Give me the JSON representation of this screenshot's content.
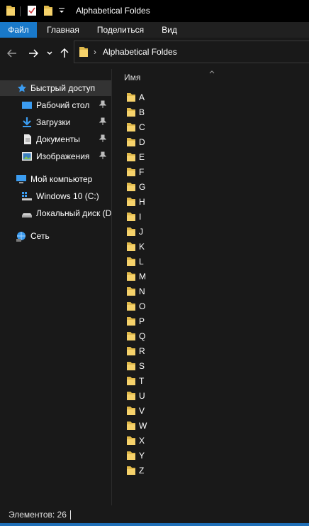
{
  "window": {
    "title": "Alphabetical Foldes"
  },
  "ribbon": {
    "tabs": [
      {
        "label": "Файл",
        "active": true
      },
      {
        "label": "Главная"
      },
      {
        "label": "Поделиться"
      },
      {
        "label": "Вид"
      }
    ]
  },
  "address": {
    "path": "Alphabetical Foldes"
  },
  "sidebar": {
    "quick_access": "Быстрый доступ",
    "pinned": [
      {
        "label": "Рабочий стол",
        "icon": "desktop-icon"
      },
      {
        "label": "Загрузки",
        "icon": "downloads-icon"
      },
      {
        "label": "Документы",
        "icon": "documents-icon"
      },
      {
        "label": "Изображения",
        "icon": "pictures-icon"
      }
    ],
    "this_pc": "Мой компьютер",
    "drives": [
      {
        "label": "Windows 10 (C:)",
        "icon": "windows-drive-icon"
      },
      {
        "label": "Локальный диск (D",
        "icon": "local-disk-icon"
      }
    ],
    "network": "Сеть"
  },
  "content": {
    "column_header": "Имя",
    "folders": [
      "A",
      "B",
      "C",
      "D",
      "E",
      "F",
      "G",
      "H",
      "I",
      "J",
      "K",
      "L",
      "M",
      "N",
      "O",
      "P",
      "Q",
      "R",
      "S",
      "T",
      "U",
      "V",
      "W",
      "X",
      "Y",
      "Z"
    ]
  },
  "status": {
    "items_count": "Элементов: 26"
  },
  "colors": {
    "accent": "#1979ca",
    "folder": "#f6d26b",
    "background": "#191919",
    "titlebar": "#000000"
  }
}
